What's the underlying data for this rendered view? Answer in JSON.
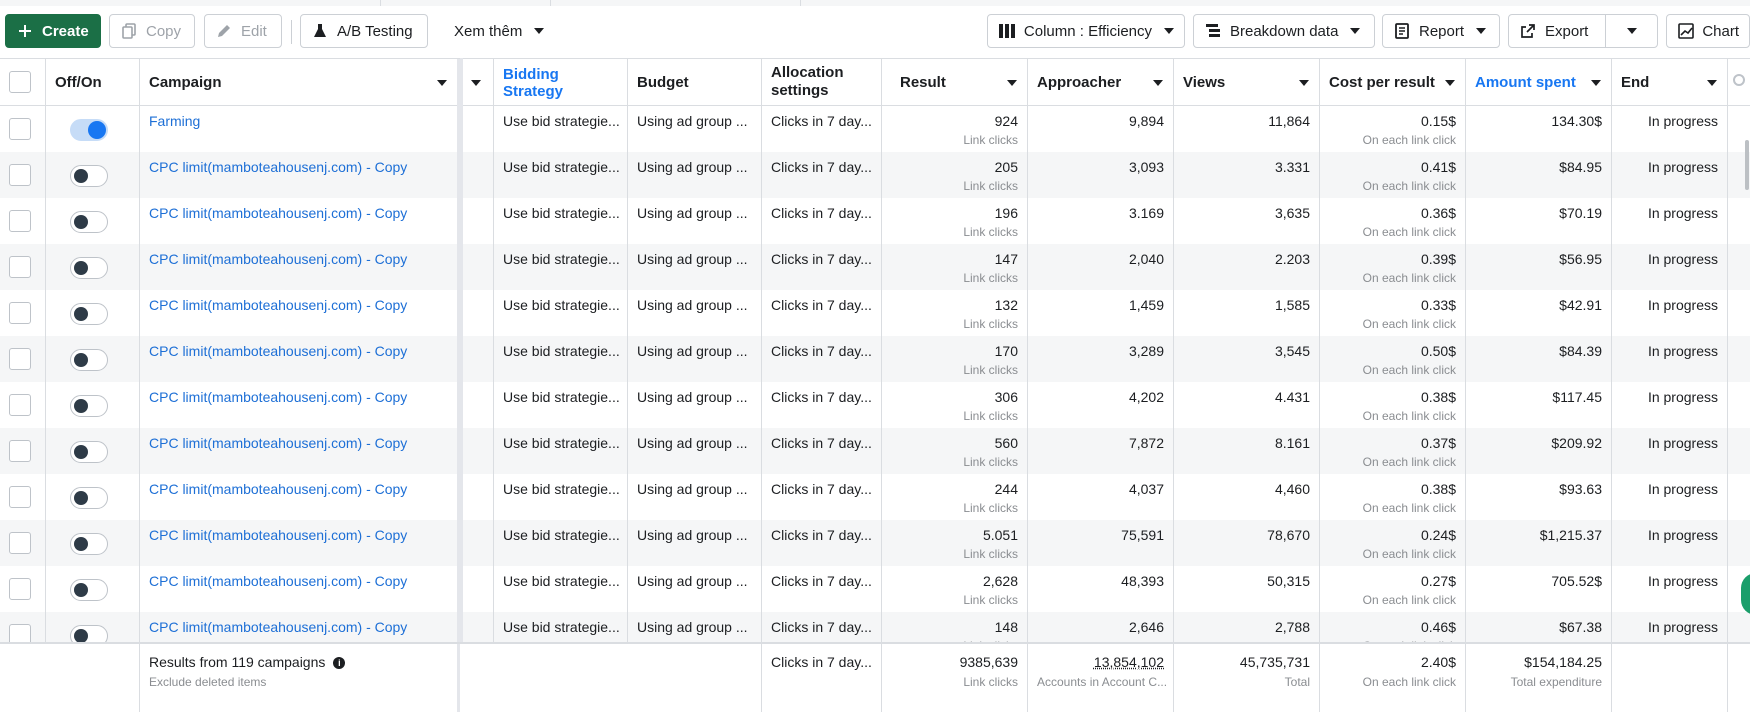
{
  "toolbar": {
    "create": "Create",
    "copy": "Copy",
    "edit": "Edit",
    "ab_testing": "A/B Testing",
    "more": "Xem thêm",
    "column": "Column : Efficiency",
    "breakdown": "Breakdown data",
    "report": "Report",
    "export": "Export",
    "chart": "Chart"
  },
  "columns": {
    "off_on": "Off/On",
    "campaign": "Campaign",
    "bidding": "Bidding Strategy",
    "budget": "Budget",
    "allocation": "Allocation settings",
    "result": "Result",
    "approacher": "Approacher",
    "views": "Views",
    "cost_per_result": "Cost per result",
    "amount_spent": "Amount spent",
    "end": "End"
  },
  "colors": {
    "accent": "#1877f2",
    "primary_button": "#1b6f46",
    "link": "#1d6fd6"
  },
  "rows": [
    {
      "on": true,
      "campaign": "Farming",
      "bidding": "Use bid strategie...",
      "budget": "Using ad group ...",
      "allocation": "Clicks in 7 day...",
      "result": "924",
      "result_sub": "Link clicks",
      "approacher": "9,894",
      "views": "11,864",
      "cpr": "0.15$",
      "cpr_sub": "On each link click",
      "spent": "134.30$",
      "end": "In progress"
    },
    {
      "on": false,
      "campaign": "CPC limit(mamboteahousenj.com) - Copy",
      "bidding": "Use bid strategie...",
      "budget": "Using ad group ...",
      "allocation": "Clicks in 7 day...",
      "result": "205",
      "result_sub": "Link clicks",
      "approacher": "3,093",
      "views": "3.331",
      "cpr": "0.41$",
      "cpr_sub": "On each link click",
      "spent": "$84.95",
      "end": "In progress"
    },
    {
      "on": false,
      "campaign": "CPC limit(mamboteahousenj.com) - Copy",
      "bidding": "Use bid strategie...",
      "budget": "Using ad group ...",
      "allocation": "Clicks in 7 day...",
      "result": "196",
      "result_sub": "Link clicks",
      "approacher": "3.169",
      "views": "3,635",
      "cpr": "0.36$",
      "cpr_sub": "On each link click",
      "spent": "$70.19",
      "end": "In progress"
    },
    {
      "on": false,
      "campaign": "CPC limit(mamboteahousenj.com) - Copy",
      "bidding": "Use bid strategie...",
      "budget": "Using ad group ...",
      "allocation": "Clicks in 7 day...",
      "result": "147",
      "result_sub": "Link clicks",
      "approacher": "2,040",
      "views": "2.203",
      "cpr": "0.39$",
      "cpr_sub": "On each link click",
      "spent": "$56.95",
      "end": "In progress"
    },
    {
      "on": false,
      "campaign": "CPC limit(mamboteahousenj.com) - Copy",
      "bidding": "Use bid strategie...",
      "budget": "Using ad group ...",
      "allocation": "Clicks in 7 day...",
      "result": "132",
      "result_sub": "Link clicks",
      "approacher": "1,459",
      "views": "1,585",
      "cpr": "0.33$",
      "cpr_sub": "On each link click",
      "spent": "$42.91",
      "end": "In progress"
    },
    {
      "on": false,
      "campaign": "CPC limit(mamboteahousenj.com) - Copy",
      "bidding": "Use bid strategie...",
      "budget": "Using ad group ...",
      "allocation": "Clicks in 7 day...",
      "result": "170",
      "result_sub": "Link clicks",
      "approacher": "3,289",
      "views": "3,545",
      "cpr": "0.50$",
      "cpr_sub": "On each link click",
      "spent": "$84.39",
      "end": "In progress"
    },
    {
      "on": false,
      "campaign": "CPC limit(mamboteahousenj.com) - Copy",
      "bidding": "Use bid strategie...",
      "budget": "Using ad group ...",
      "allocation": "Clicks in 7 day...",
      "result": "306",
      "result_sub": "Link clicks",
      "approacher": "4,202",
      "views": "4.431",
      "cpr": "0.38$",
      "cpr_sub": "On each link click",
      "spent": "$117.45",
      "end": "In progress"
    },
    {
      "on": false,
      "campaign": "CPC limit(mamboteahousenj.com) - Copy",
      "bidding": "Use bid strategie...",
      "budget": "Using ad group ...",
      "allocation": "Clicks in 7 day...",
      "result": "560",
      "result_sub": "Link clicks",
      "approacher": "7,872",
      "views": "8.161",
      "cpr": "0.37$",
      "cpr_sub": "On each link click",
      "spent": "$209.92",
      "end": "In progress"
    },
    {
      "on": false,
      "campaign": "CPC limit(mamboteahousenj.com) - Copy",
      "bidding": "Use bid strategie...",
      "budget": "Using ad group ...",
      "allocation": "Clicks in 7 day...",
      "result": "244",
      "result_sub": "Link clicks",
      "approacher": "4,037",
      "views": "4,460",
      "cpr": "0.38$",
      "cpr_sub": "On each link click",
      "spent": "$93.63",
      "end": "In progress"
    },
    {
      "on": false,
      "campaign": "CPC limit(mamboteahousenj.com) - Copy",
      "bidding": "Use bid strategie...",
      "budget": "Using ad group ...",
      "allocation": "Clicks in 7 day...",
      "result": "5.051",
      "result_sub": "Link clicks",
      "approacher": "75,591",
      "views": "78,670",
      "cpr": "0.24$",
      "cpr_sub": "On each link click",
      "spent": "$1,215.37",
      "end": "In progress"
    },
    {
      "on": false,
      "campaign": "CPC limit(mamboteahousenj.com) - Copy",
      "bidding": "Use bid strategie...",
      "budget": "Using ad group ...",
      "allocation": "Clicks in 7 day...",
      "result": "2,628",
      "result_sub": "Link clicks",
      "approacher": "48,393",
      "views": "50,315",
      "cpr": "0.27$",
      "cpr_sub": "On each link click",
      "spent": "705.52$",
      "end": "In progress"
    },
    {
      "on": false,
      "campaign": "CPC limit(mamboteahousenj.com) - Copy",
      "bidding": "Use bid strategie...",
      "budget": "Using ad group ...",
      "allocation": "Clicks in 7 day...",
      "result": "148",
      "result_sub": "Link clicks",
      "approacher": "2,646",
      "views": "2,788",
      "cpr": "0.46$",
      "cpr_sub": "On each link click",
      "spent": "$67.38",
      "end": "In progress"
    }
  ],
  "footer": {
    "summary": "Results from 119 campaigns",
    "summary_sub": "Exclude deleted items",
    "allocation": "Clicks in 7 day...",
    "result": "9385,639",
    "result_sub": "Link clicks",
    "approacher": "13,854,102",
    "approacher_sub": "Accounts in Account C...",
    "views": "45,735,731",
    "views_sub": "Total",
    "cpr": "2.40$",
    "cpr_sub": "On each link click",
    "spent": "$154,184.25",
    "spent_sub": "Total expenditure"
  }
}
